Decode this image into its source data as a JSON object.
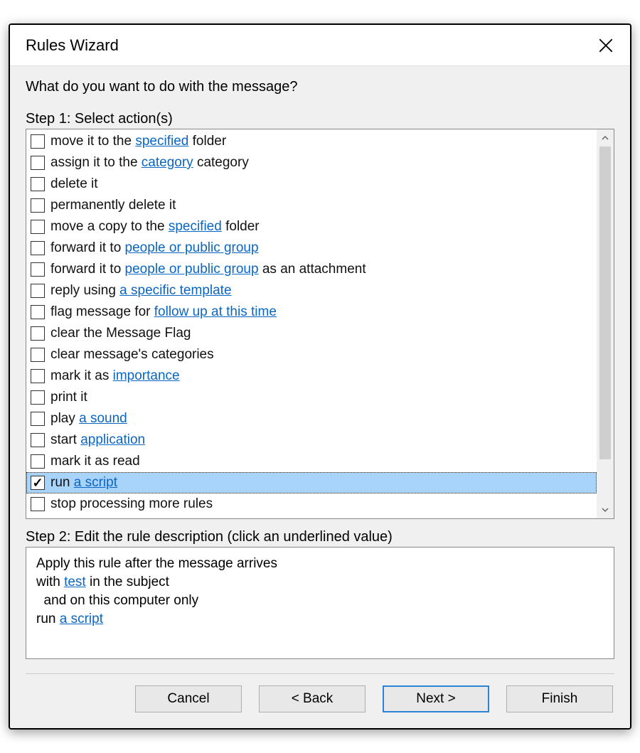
{
  "window": {
    "title": "Rules Wizard"
  },
  "heading": "What do you want to do with the message?",
  "step1_label": "Step 1: Select action(s)",
  "step2_label": "Step 2: Edit the rule description (click an underlined value)",
  "actions": [
    {
      "checked": false,
      "selected": false,
      "parts": [
        {
          "t": "text",
          "v": "move it to the "
        },
        {
          "t": "link",
          "v": "specified"
        },
        {
          "t": "text",
          "v": " folder"
        }
      ]
    },
    {
      "checked": false,
      "selected": false,
      "parts": [
        {
          "t": "text",
          "v": "assign it to the "
        },
        {
          "t": "link",
          "v": "category"
        },
        {
          "t": "text",
          "v": " category"
        }
      ]
    },
    {
      "checked": false,
      "selected": false,
      "parts": [
        {
          "t": "text",
          "v": "delete it"
        }
      ]
    },
    {
      "checked": false,
      "selected": false,
      "parts": [
        {
          "t": "text",
          "v": "permanently delete it"
        }
      ]
    },
    {
      "checked": false,
      "selected": false,
      "parts": [
        {
          "t": "text",
          "v": "move a copy to the "
        },
        {
          "t": "link",
          "v": "specified"
        },
        {
          "t": "text",
          "v": " folder"
        }
      ]
    },
    {
      "checked": false,
      "selected": false,
      "parts": [
        {
          "t": "text",
          "v": "forward it to "
        },
        {
          "t": "link",
          "v": "people or public group"
        }
      ]
    },
    {
      "checked": false,
      "selected": false,
      "parts": [
        {
          "t": "text",
          "v": "forward it to "
        },
        {
          "t": "link",
          "v": "people or public group"
        },
        {
          "t": "text",
          "v": " as an attachment"
        }
      ]
    },
    {
      "checked": false,
      "selected": false,
      "parts": [
        {
          "t": "text",
          "v": "reply using "
        },
        {
          "t": "link",
          "v": "a specific template"
        }
      ]
    },
    {
      "checked": false,
      "selected": false,
      "parts": [
        {
          "t": "text",
          "v": "flag message for "
        },
        {
          "t": "link",
          "v": "follow up at this time"
        }
      ]
    },
    {
      "checked": false,
      "selected": false,
      "parts": [
        {
          "t": "text",
          "v": "clear the Message Flag"
        }
      ]
    },
    {
      "checked": false,
      "selected": false,
      "parts": [
        {
          "t": "text",
          "v": "clear message's categories"
        }
      ]
    },
    {
      "checked": false,
      "selected": false,
      "parts": [
        {
          "t": "text",
          "v": "mark it as "
        },
        {
          "t": "link",
          "v": "importance"
        }
      ]
    },
    {
      "checked": false,
      "selected": false,
      "parts": [
        {
          "t": "text",
          "v": "print it"
        }
      ]
    },
    {
      "checked": false,
      "selected": false,
      "parts": [
        {
          "t": "text",
          "v": "play "
        },
        {
          "t": "link",
          "v": "a sound"
        }
      ]
    },
    {
      "checked": false,
      "selected": false,
      "parts": [
        {
          "t": "text",
          "v": "start "
        },
        {
          "t": "link",
          "v": "application"
        }
      ]
    },
    {
      "checked": false,
      "selected": false,
      "parts": [
        {
          "t": "text",
          "v": "mark it as read"
        }
      ]
    },
    {
      "checked": true,
      "selected": true,
      "parts": [
        {
          "t": "text",
          "v": "run "
        },
        {
          "t": "link",
          "v": "a script"
        }
      ]
    },
    {
      "checked": false,
      "selected": false,
      "parts": [
        {
          "t": "text",
          "v": "stop processing more rules"
        }
      ]
    }
  ],
  "description": {
    "line1": "Apply this rule after the message arrives",
    "line2_pre": "with ",
    "line2_link": "test",
    "line2_post": " in the subject",
    "line3": "  and on this computer only",
    "line4_pre": "run ",
    "line4_link": "a script"
  },
  "buttons": {
    "cancel": "Cancel",
    "back": "< Back",
    "next": "Next >",
    "finish": "Finish"
  }
}
